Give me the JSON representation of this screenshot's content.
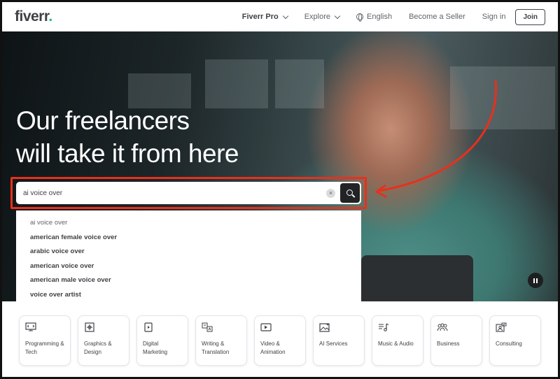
{
  "header": {
    "logo": "fiverr",
    "logo_dot": ".",
    "nav": {
      "fiverr_pro": "Fiverr Pro",
      "explore": "Explore",
      "language": "English",
      "become_seller": "Become a Seller",
      "sign_in": "Sign in",
      "join": "Join"
    }
  },
  "hero": {
    "title_line1": "Our freelancers",
    "title_line2": "will take it from here"
  },
  "search": {
    "value": "ai voice over",
    "clear_symbol": "×",
    "suggestions": [
      "ai voice over",
      "american female voice over",
      "arabic voice over",
      "american voice over",
      "american male voice over",
      "voice over artist"
    ]
  },
  "categories": [
    {
      "icon": "monitor-code-icon",
      "label": "Programming & Tech"
    },
    {
      "icon": "pen-tool-icon",
      "label": "Graphics & Design"
    },
    {
      "icon": "phone-play-icon",
      "label": "Digital Marketing"
    },
    {
      "icon": "translate-icon",
      "label": "Writing & Translation"
    },
    {
      "icon": "video-play-icon",
      "label": "Video & Animation"
    },
    {
      "icon": "ai-image-icon",
      "label": "AI Services"
    },
    {
      "icon": "music-note-icon",
      "label": "Music & Audio"
    },
    {
      "icon": "people-icon",
      "label": "Business"
    },
    {
      "icon": "consulting-icon",
      "label": "Consulting"
    }
  ],
  "colors": {
    "annotation": "#e8301c",
    "brand_green": "#1dbf73",
    "search_button": "#222325"
  }
}
